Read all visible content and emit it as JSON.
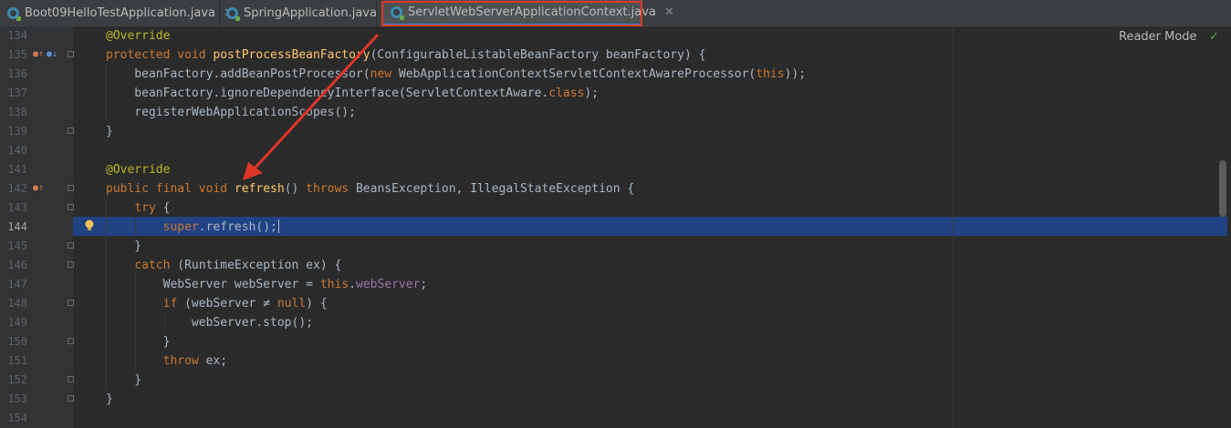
{
  "tabs": [
    {
      "label": "Boot09HelloTestApplication.java",
      "close": "✕"
    },
    {
      "label": "SpringApplication.java",
      "close": "✕"
    },
    {
      "label": "ServletWebServerApplicationContext.java",
      "close": "✕"
    }
  ],
  "editor": {
    "reader_mode": "Reader Mode",
    "check_icon": "✓",
    "line_numbers": [
      "134",
      "135",
      "136",
      "137",
      "138",
      "139",
      "140",
      "141",
      "142",
      "143",
      "144",
      "145",
      "146",
      "147",
      "148",
      "149",
      "150",
      "151",
      "152",
      "153",
      "154"
    ],
    "current_line": "144"
  },
  "colors": {
    "keyword": "#cc7832",
    "annotation": "#bbb529",
    "method_decl": "#ffc66d",
    "field": "#9876aa",
    "selection": "#214283",
    "highlight_box": "#e0352b"
  },
  "code_lines": [
    [
      {
        "t": "@Override",
        "c": "a"
      }
    ],
    [
      {
        "t": "protected void ",
        "c": "k"
      },
      {
        "t": "postProcessBeanFactory",
        "c": "fn"
      },
      {
        "t": "(ConfigurableListableBeanFactory beanFactory) {"
      }
    ],
    [
      {
        "t": "    beanFactory.addBeanPostProcessor("
      },
      {
        "t": "new ",
        "c": "k"
      },
      {
        "t": "WebApplicationContextServletContextAwareProcessor("
      },
      {
        "t": "this",
        "c": "k"
      },
      {
        "t": "));"
      }
    ],
    [
      {
        "t": "    beanFactory.ignoreDependencyInterface(ServletContextAware."
      },
      {
        "t": "class",
        "c": "k"
      },
      {
        "t": ");"
      }
    ],
    [
      {
        "t": "    registerWebApplicationScopes();"
      }
    ],
    [
      {
        "t": "}"
      }
    ],
    [],
    [
      {
        "t": "@Override",
        "c": "a"
      }
    ],
    [
      {
        "t": "public final void ",
        "c": "k"
      },
      {
        "t": "refresh",
        "c": "fn"
      },
      {
        "t": "() "
      },
      {
        "t": "throws ",
        "c": "k"
      },
      {
        "t": "BeansException, IllegalStateException {"
      }
    ],
    [
      {
        "t": "    "
      },
      {
        "t": "try ",
        "c": "k"
      },
      {
        "t": "{"
      }
    ],
    [
      {
        "t": "        "
      },
      {
        "t": "super",
        "c": "k"
      },
      {
        "t": ".refresh();"
      }
    ],
    [
      {
        "t": "    }"
      }
    ],
    [
      {
        "t": "    "
      },
      {
        "t": "catch ",
        "c": "k"
      },
      {
        "t": "(RuntimeException ex) {"
      }
    ],
    [
      {
        "t": "        WebServer webServer = "
      },
      {
        "t": "this",
        "c": "k"
      },
      {
        "t": "."
      },
      {
        "t": "webServer",
        "c": "f"
      },
      {
        "t": ";"
      }
    ],
    [
      {
        "t": "        "
      },
      {
        "t": "if ",
        "c": "k"
      },
      {
        "t": "(webServer ≠ "
      },
      {
        "t": "null",
        "c": "k"
      },
      {
        "t": ") {"
      }
    ],
    [
      {
        "t": "            webServer.stop();"
      }
    ],
    [
      {
        "t": "        }"
      }
    ],
    [
      {
        "t": "        "
      },
      {
        "t": "throw ",
        "c": "k"
      },
      {
        "t": "ex;"
      }
    ],
    [
      {
        "t": "    }"
      }
    ],
    [
      {
        "t": "}"
      }
    ],
    []
  ]
}
